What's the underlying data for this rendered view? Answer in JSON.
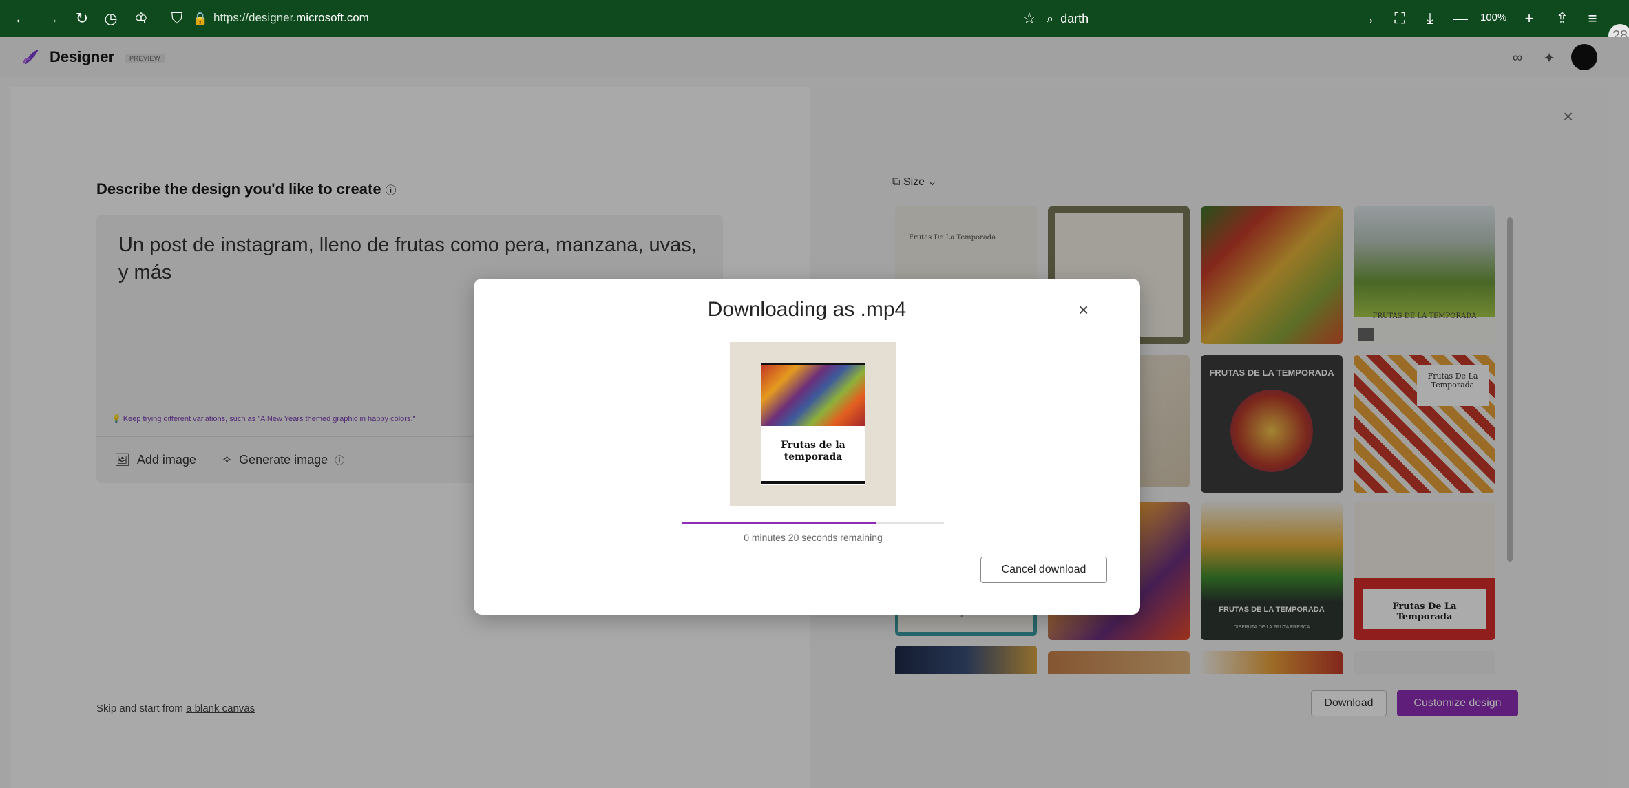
{
  "browser": {
    "url_prefix": "https://designer.",
    "url_domain": "microsoft.com",
    "search_query": "darth",
    "zoom": "100%",
    "badge": "28"
  },
  "app": {
    "brand": "Designer",
    "preview_tag": "PREVIEW"
  },
  "left": {
    "title": "Describe the design you'd like to create",
    "prompt_text": "Un post de instagram, lleno de frutas como pera, manzana, uvas, y más",
    "tip": "Keep trying different variations, such as \"A New Years themed graphic in happy colors.\"",
    "add_image": "Add image",
    "generate_image": "Generate image",
    "skip_prefix": "Skip and start from ",
    "skip_link": "a blank canvas"
  },
  "right": {
    "size_label": "Size",
    "download_label": "Download",
    "customize_label": "Customize design",
    "thumb_texts": {
      "t1": "Frutas De La Temporada",
      "t4": "FRUTAS DE LA TEMPORADA",
      "t6": "FRUTAS DE LA TEMPORADA",
      "t7": "Frutas De La Temporada",
      "t10": "FRUTAS DE LA TEMPORADA",
      "t10_sub": "DISFRUTA DE LA FRUTA FRESCA",
      "t11": "Frutas De La Temporada",
      "t9": "Temporada"
    }
  },
  "modal": {
    "title": "Downloading as .mp4",
    "preview_title": "Frutas de la temporada",
    "remaining": "0 minutes 20 seconds remaining",
    "cancel_label": "Cancel download",
    "progress": 0.74
  },
  "colors": {
    "browser_bar": "#0f4a1f",
    "accent": "#8d2db5"
  }
}
